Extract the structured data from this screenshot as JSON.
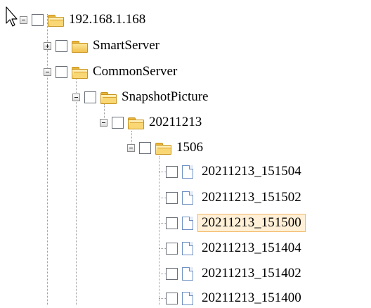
{
  "tree": {
    "root": {
      "label": "192.168.1.168",
      "expanded": true,
      "checked": false
    },
    "nodes": [
      {
        "label": "SmartServer",
        "type": "folder",
        "expanded": false,
        "checked": false
      },
      {
        "label": "CommonServer",
        "type": "folder",
        "expanded": true,
        "checked": false
      },
      {
        "label": "SnapshotPicture",
        "type": "folder",
        "expanded": true,
        "checked": false
      },
      {
        "label": "20211213",
        "type": "folder",
        "expanded": true,
        "checked": false
      },
      {
        "label": "1506",
        "type": "folder",
        "expanded": true,
        "checked": false
      }
    ],
    "files": [
      {
        "label": "20211213_151504",
        "selected": false,
        "checked": false
      },
      {
        "label": "20211213_151502",
        "selected": false,
        "checked": false
      },
      {
        "label": "20211213_151500",
        "selected": true,
        "checked": false
      },
      {
        "label": "20211213_151404",
        "selected": false,
        "checked": false
      },
      {
        "label": "20211213_151402",
        "selected": false,
        "checked": false
      },
      {
        "label": "20211213_151400",
        "selected": false,
        "checked": false
      }
    ]
  },
  "colors": {
    "selection_background": "#fff0d7",
    "selection_border": "#f2b866",
    "folder_yellow": "#f1c14f",
    "file_blue": "#6d8fc2"
  }
}
